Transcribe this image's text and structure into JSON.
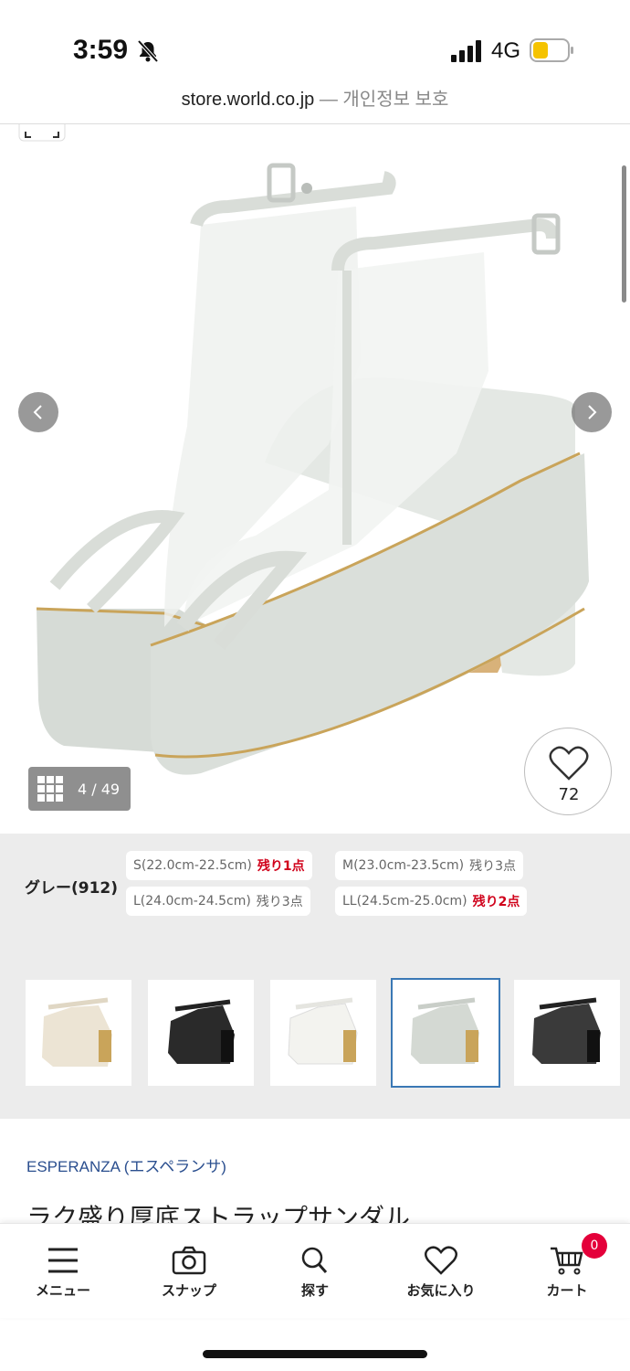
{
  "status_bar": {
    "time": "3:59",
    "network": "4G",
    "battery_color": "#f5c300"
  },
  "url_bar": {
    "domain": "store.world.co.jp",
    "separator": " — ",
    "privacy": "개인정보 보호"
  },
  "gallery": {
    "counter": "4 / 49",
    "favorite_count": "72",
    "product_color": "#d9ddd8",
    "accent_gold": "#c9a45a"
  },
  "variants": {
    "color_label": "グレー(912)",
    "sizes": [
      {
        "size": "S(22.0cm-22.5cm)",
        "stock": "残り1点",
        "low": true
      },
      {
        "size": "M(23.0cm-23.5cm)",
        "stock": "残り3点",
        "low": false
      },
      {
        "size": "L(24.0cm-24.5cm)",
        "stock": "残り3点",
        "low": false
      },
      {
        "size": "LL(24.5cm-25.0cm)",
        "stock": "残り2点",
        "low": true
      }
    ],
    "thumbnails": [
      {
        "color_name": "beige",
        "hex": "#ece4d4"
      },
      {
        "color_name": "black",
        "hex": "#2a2a2a"
      },
      {
        "color_name": "white",
        "hex": "#f7f7f3"
      },
      {
        "color_name": "grey",
        "hex": "#d4d9d3"
      },
      {
        "color_name": "black-mesh",
        "hex": "#3a3a3a"
      }
    ],
    "selected_index": 3
  },
  "product": {
    "brand": "ESPERANZA (エスペランサ)",
    "title": "ラク盛り厚底ストラップサンダル"
  },
  "nav": {
    "menu": "メニュー",
    "snap": "スナップ",
    "search": "探す",
    "favorites": "お気に入り",
    "cart": "カート",
    "cart_badge": "0"
  }
}
